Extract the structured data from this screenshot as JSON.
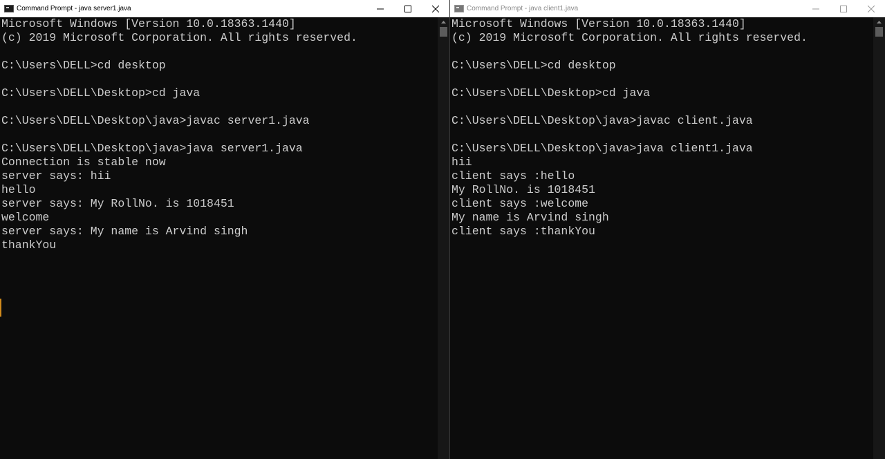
{
  "server_window": {
    "title": "Command Prompt - java  server1.java",
    "lines": [
      "Microsoft Windows [Version 10.0.18363.1440]",
      "(c) 2019 Microsoft Corporation. All rights reserved.",
      "",
      "C:\\Users\\DELL>cd desktop",
      "",
      "C:\\Users\\DELL\\Desktop>cd java",
      "",
      "C:\\Users\\DELL\\Desktop\\java>javac server1.java",
      "",
      "C:\\Users\\DELL\\Desktop\\java>java server1.java",
      "Connection is stable now",
      "server says: hii",
      "hello",
      "server says: My RollNo. is 1018451",
      "welcome",
      "server says: My name is Arvind singh",
      "thankYou"
    ]
  },
  "client_window": {
    "title": "Command Prompt - java  client1.java",
    "lines": [
      "Microsoft Windows [Version 10.0.18363.1440]",
      "(c) 2019 Microsoft Corporation. All rights reserved.",
      "",
      "C:\\Users\\DELL>cd desktop",
      "",
      "C:\\Users\\DELL\\Desktop>cd java",
      "",
      "C:\\Users\\DELL\\Desktop\\java>javac client.java",
      "",
      "C:\\Users\\DELL\\Desktop\\java>java client1.java",
      "hii",
      "client says :hello",
      "My RollNo. is 1018451",
      "client says :welcome",
      "My name is Arvind singh",
      "client says :thankYou"
    ]
  },
  "icons": {
    "app": "cmd-icon",
    "minimize": "minimize-icon",
    "maximize": "maximize-icon",
    "close": "close-icon"
  },
  "colors": {
    "console_bg": "#0c0c0c",
    "console_text": "#cccccc",
    "titlebar_active": "#ffffff"
  }
}
